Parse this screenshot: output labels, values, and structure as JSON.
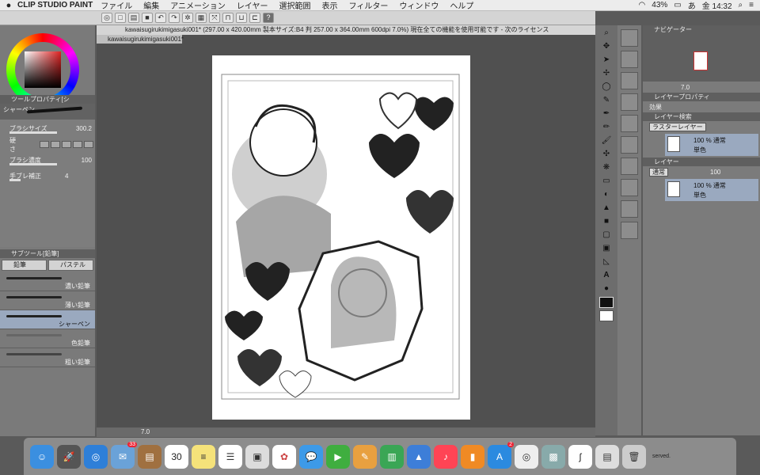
{
  "menubar": {
    "apple": "",
    "app": "CLIP STUDIO PAINT",
    "items": [
      "ファイル",
      "編集",
      "アニメーション",
      "レイヤー",
      "選択範囲",
      "表示",
      "フィルター",
      "ウィンドウ",
      "ヘルプ"
    ],
    "battery": "43%",
    "clock": "金 14:32"
  },
  "document": {
    "title": "kawaisugirukimigasuki001* (297.00 x 420.00mm 製本サイズ:B4 判 257.00 x 364.00mm 600dpi 7.0%) 現在全ての機能を使用可能です - 次のライセンス",
    "tab": "kawaisugirukimigasuki001*"
  },
  "color": {
    "h": "H",
    "s": "0",
    "v": "100"
  },
  "tool_property": {
    "header": "ツールプロパティ[シ",
    "brush": "シャーペン",
    "brush_size_label": "ブラシサイズ",
    "brush_size": "300.2",
    "hardness_label": "硬さ",
    "density_label": "ブラシ濃度",
    "density": "100",
    "stabilize_label": "手ブレ補正",
    "stabilize": "4"
  },
  "sub_tool": {
    "header": "サブツール[鉛筆]",
    "tabs": [
      "鉛筆",
      "パステル"
    ],
    "items": [
      {
        "label": "濃い鉛筆",
        "selected": false
      },
      {
        "label": "薄い鉛筆",
        "selected": false
      },
      {
        "label": "シャーペン",
        "selected": true
      },
      {
        "label": "色鉛筆",
        "selected": false
      },
      {
        "label": "粗い鉛筆",
        "selected": false
      }
    ]
  },
  "status": {
    "zoom": "7.0"
  },
  "navigator": {
    "header": "ナビゲーター",
    "zoom": "7.0"
  },
  "layer_property": {
    "header": "レイヤープロパティ",
    "effect": "効果"
  },
  "layer_search": {
    "header": "レイヤー検索",
    "type": "ラスターレイヤー"
  },
  "search_result": {
    "opacity": "100 % 通常",
    "name": "単色"
  },
  "layers": {
    "header": "レイヤー",
    "blend": "通常",
    "opacity": "100",
    "items": [
      {
        "opacity": "100 % 通常",
        "name": "単色"
      }
    ]
  },
  "dock": {
    "mail_badge": "33",
    "calendar_day": "30",
    "appstore_badge": "2",
    "footer": "served."
  }
}
